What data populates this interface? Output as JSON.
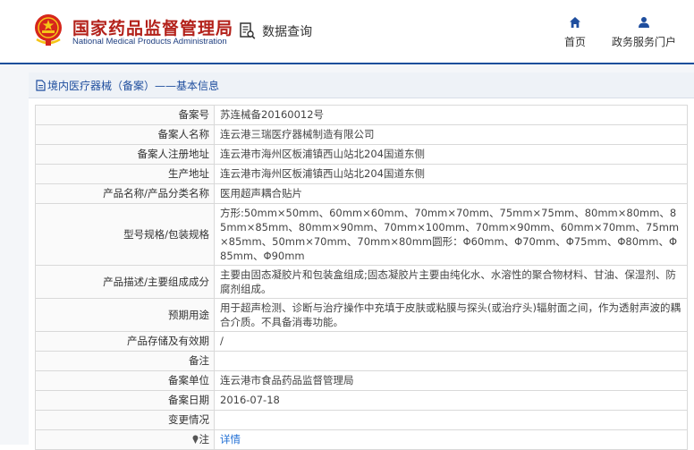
{
  "header": {
    "title": "国家药品监督管理局",
    "subtitle": "National Medical Products Administration",
    "query_label": "数据查询",
    "nav": [
      {
        "label": "首页",
        "icon": "home-icon"
      },
      {
        "label": "政务服务门户",
        "icon": "user-icon"
      }
    ],
    "colors": {
      "title": "#b3211a",
      "subtitle": "#1f3f80",
      "rule": "#1a4f9c"
    }
  },
  "breadcrumb": "境内医疗器械（备案）——基本信息",
  "table": {
    "rows": [
      {
        "label": "备案号",
        "value": "苏连械备20160012号"
      },
      {
        "label": "备案人名称",
        "value": "连云港三瑞医疗器械制造有限公司"
      },
      {
        "label": "备案人注册地址",
        "value": "连云港市海州区板浦镇西山站北204国道东侧"
      },
      {
        "label": "生产地址",
        "value": "连云港市海州区板浦镇西山站北204国道东侧"
      },
      {
        "label": "产品名称/产品分类名称",
        "value": "医用超声耦合贴片"
      },
      {
        "label": "型号规格/包装规格",
        "value": "方形:50mm×50mm、60mm×60mm、70mm×70mm、75mm×75mm、80mm×80mm、85mm×85mm、80mm×90mm、70mm×100mm、70mm×90mm、60mm×70mm、75mm×85mm、50mm×70mm、70mm×80mm圆形：Φ60mm、Φ70mm、Φ75mm、Φ80mm、Φ85mm、Φ90mm"
      },
      {
        "label": "产品描述/主要组成成分",
        "value": "主要由固态凝胶片和包装盒组成;固态凝胶片主要由纯化水、水溶性的聚合物材料、甘油、保湿剂、防腐剂组成。"
      },
      {
        "label": "预期用途",
        "value": "用于超声检测、诊断与治疗操作中充填于皮肤或粘膜与探头(或治疗头)辐射面之间，作为透射声波的耦合介质。不具备消毒功能。"
      },
      {
        "label": "产品存储及有效期",
        "value": "/"
      },
      {
        "label": "备注",
        "value": ""
      },
      {
        "label": "备案单位",
        "value": "连云港市食品药品监督管理局"
      },
      {
        "label": "备案日期",
        "value": "2016-07-18"
      },
      {
        "label": "变更情况",
        "value": ""
      }
    ],
    "note": {
      "label": "注",
      "icon": "pin-icon",
      "link": "详情"
    }
  }
}
